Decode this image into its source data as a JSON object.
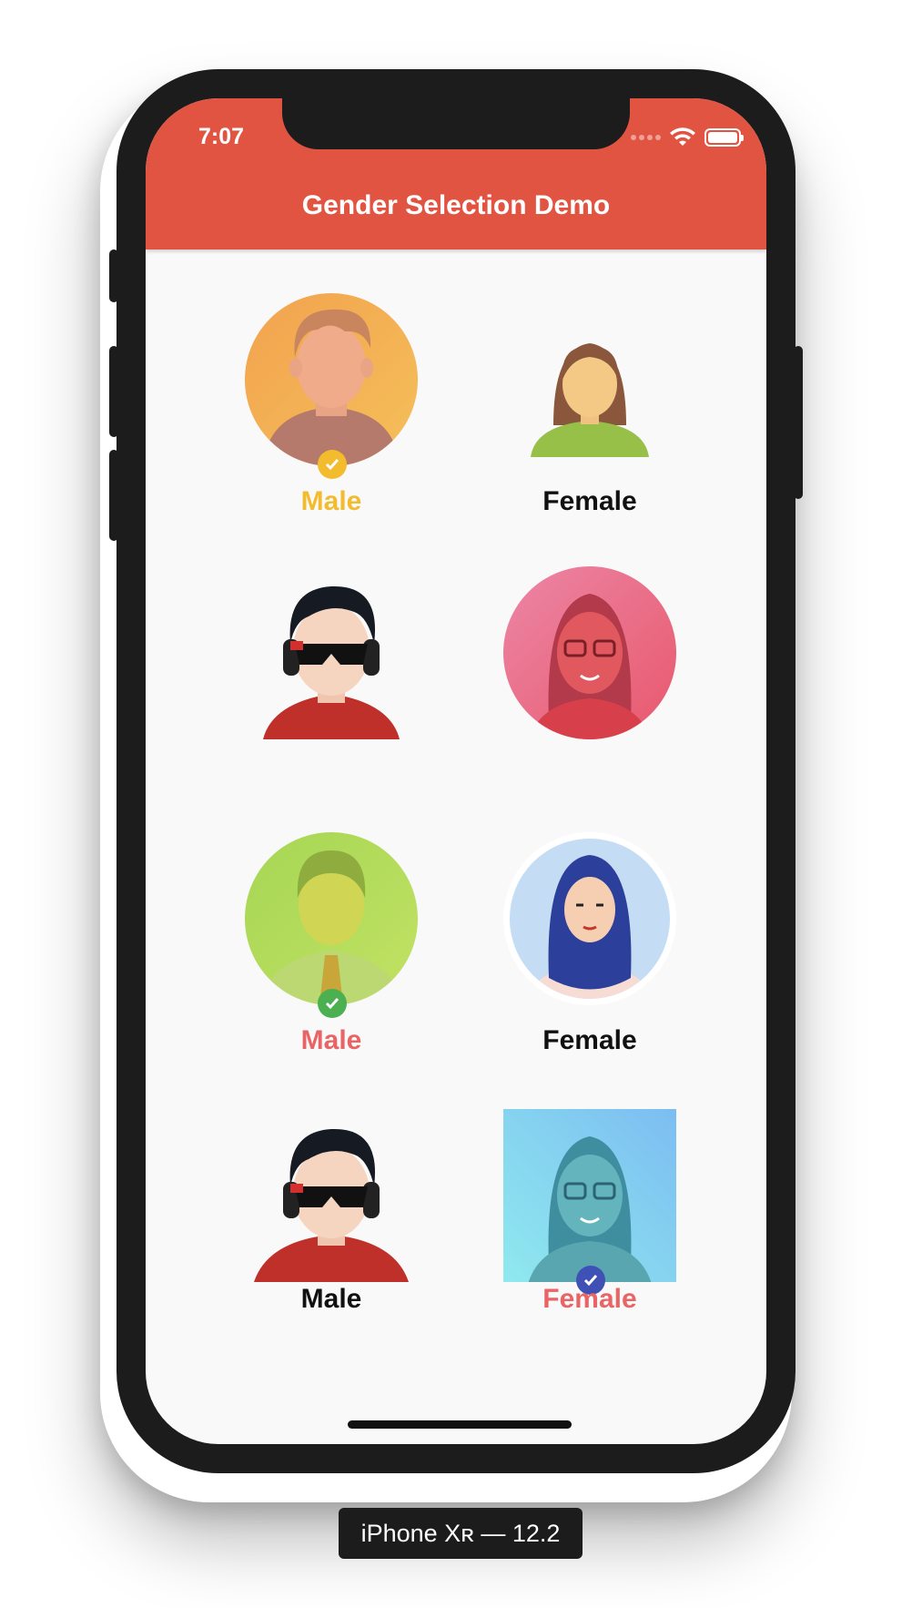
{
  "status_bar": {
    "time": "7:07"
  },
  "app_bar": {
    "title": "Gender Selection Demo",
    "color": "#e25442"
  },
  "grid": {
    "items": [
      {
        "label": "Male",
        "gender": "male",
        "selected": true,
        "label_color": "#f2bc2e",
        "check_color": "#f2bc2e",
        "avatar": "male-boy-orange-circle"
      },
      {
        "label": "Female",
        "gender": "female",
        "selected": false,
        "label_color": "#111111",
        "avatar": "female-green-shirt"
      },
      {
        "label": "",
        "gender": "male",
        "selected": false,
        "avatar": "male-dj-headphones"
      },
      {
        "label": "",
        "gender": "female",
        "selected": false,
        "avatar": "female-glasses-pink-circle"
      },
      {
        "label": "Male",
        "gender": "male",
        "selected": true,
        "label_color": "#e96565",
        "check_color": "#4caf50",
        "avatar": "male-green-circle-tie"
      },
      {
        "label": "Female",
        "gender": "female",
        "selected": false,
        "label_color": "#111111",
        "avatar": "female-hijab-circle"
      },
      {
        "label": "Male",
        "gender": "male",
        "selected": false,
        "label_color": "#111111",
        "avatar": "male-dj-headphones"
      },
      {
        "label": "Female",
        "gender": "female",
        "selected": true,
        "label_color": "#e96565",
        "check_color": "#3f51b5",
        "avatar": "female-glasses-blue-square"
      }
    ]
  },
  "device_caption": "iPhone Xʀ — 12.2"
}
